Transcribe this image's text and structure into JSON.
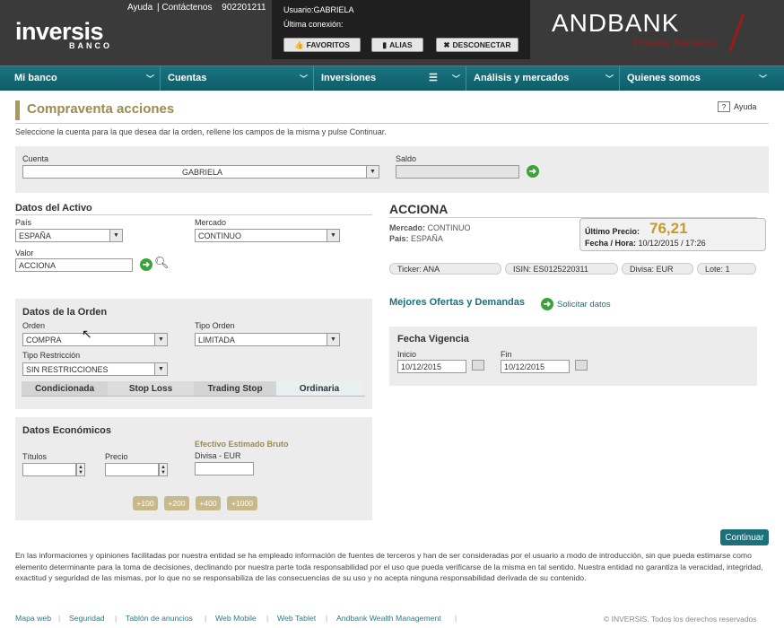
{
  "header": {
    "logo": "inversis",
    "logo_sub": "BANCO",
    "links": [
      "Ayuda",
      "Contáctenos",
      "902201211"
    ],
    "user_line": "Usuario:GABRIELA",
    "last_conn": "Última conexión:",
    "buttons": {
      "favoritos": "FAVORITOS",
      "alias": "ALIAS",
      "desconectar": "DESCONECTAR"
    },
    "brand": "ANDBANK",
    "brand_sub": "Private Bankers"
  },
  "nav": [
    "Mi banco",
    "Cuentas",
    "Inversiones",
    "Análisis y mercados",
    "Quienes somos"
  ],
  "page": {
    "title": "Compraventa acciones",
    "help": "Ayuda",
    "help_icon": "?",
    "intro": "Seleccione la cuenta para la que desea dar la orden, rellene los campos de la misma y pulse Continuar."
  },
  "account": {
    "label": "Cuenta",
    "value": "GABRIELA",
    "saldo_label": "Saldo",
    "saldo_value": ""
  },
  "asset": {
    "heading": "Datos del Activo",
    "pais_label": "País",
    "pais": "ESPAÑA",
    "mercado_label": "Mercado",
    "mercado": "CONTINUO",
    "valor_label": "Valor",
    "valor": "ACCIONA"
  },
  "order": {
    "heading": "Datos de la Orden",
    "orden_label": "Orden",
    "orden": "COMPRA",
    "tipo_label": "Tipo Orden",
    "tipo": "LIMITADA",
    "restr_label": "Tipo Restricción",
    "restr": "SIN RESTRICCIONES",
    "tabs": [
      "Condicionada",
      "Stop Loss",
      "Trading Stop",
      "Ordinaria"
    ]
  },
  "economic": {
    "heading": "Datos Económicos",
    "titulos_label": "Títulos",
    "titulos": "",
    "precio_label": "Precio",
    "precio": "",
    "efectivo_label": "Efectivo Estimado Bruto",
    "divisa_label": "Divisa - EUR",
    "efectivo": "",
    "quick": [
      "+100",
      "+200",
      "+400",
      "+1000"
    ]
  },
  "stock": {
    "name": "ACCIONA",
    "mercado_key": "Mercado:",
    "mercado": "CONTINUO",
    "pais_key": "País:",
    "pais": "ESPAÑA",
    "price_key": "Último Precio:",
    "price": "76,21",
    "date_key": "Fecha / Hora:",
    "date": "10/12/2015 / 17:26",
    "ticker": "Ticker: ANA",
    "isin": "ISIN: ES0125220311",
    "divisa": "Divisa: EUR",
    "lote": "Lote: 1"
  },
  "offers": {
    "title": "Mejores Ofertas y Demandas",
    "link": "Solicitar datos"
  },
  "validity": {
    "heading": "Fecha Vigencia",
    "inicio_label": "Inicio",
    "inicio": "10/12/2015",
    "fin_label": "Fin",
    "fin": "10/12/2015"
  },
  "continue": "Continuar",
  "disclaimer": "En las informaciones y opiniones facilitadas por nuestra entidad se ha empleado información de fuentes de terceros y han de ser consideradas por el usuario a modo de introducción, sin que pueda estimarse como elemento determinante para la toma de decisiones, declinando por nuestra parte toda responsabilidad por el uso que pueda verificarse de la misma en tal sentido. Nuestra entidad no garantiza la veracidad, integridad, exactitud y seguridad de las mismas, por lo que no se responsabiliza de las consecuencias de su uso y no acepta ninguna responsabilidad derivada de su contenido.",
  "footer": [
    "Mapa web",
    "Seguridad",
    "Tablón de anuncios",
    "Web Mobile",
    "Web Tablet",
    "Andbank Wealth Management"
  ],
  "copyright": "© INVERSIS. Todos los derechos reservados"
}
